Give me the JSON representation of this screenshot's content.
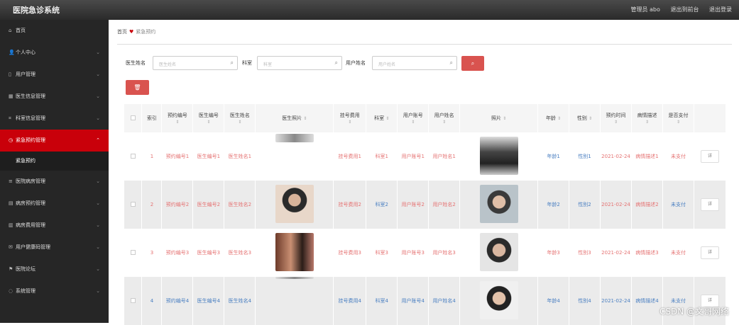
{
  "app": {
    "title": "医院急诊系统"
  },
  "topbar": {
    "user": "管理员 abo",
    "front": "退出到前台",
    "logout": "退出登录"
  },
  "sidebar": {
    "items": [
      {
        "icon": "⌂",
        "label": "首页"
      },
      {
        "icon": "👤",
        "label": "个人中心"
      },
      {
        "icon": "▯",
        "label": "用户管理"
      },
      {
        "icon": "▦",
        "label": "医生信息管理"
      },
      {
        "icon": "⌗",
        "label": "科室信息管理"
      },
      {
        "icon": "◷",
        "label": "紧急预约管理"
      },
      {
        "icon": "≡",
        "label": "医院病房管理"
      },
      {
        "icon": "▤",
        "label": "病房预约管理"
      },
      {
        "icon": "▥",
        "label": "病房费用管理"
      },
      {
        "icon": "✉",
        "label": "用户健康码管理"
      },
      {
        "icon": "⚑",
        "label": "医院论坛"
      },
      {
        "icon": "◌",
        "label": "系统管理"
      }
    ],
    "submenu": "紧急预约"
  },
  "breadcrumb": {
    "home": "首页",
    "current": "紧急预约"
  },
  "filters": {
    "doctor_label": "医生姓名",
    "doctor_placeholder": "医生姓名",
    "dept_label": "科室",
    "dept_placeholder": "科室",
    "user_label": "用户姓名",
    "user_placeholder": "用户姓名"
  },
  "table": {
    "headers": [
      "索引",
      "预约编号",
      "医生编号",
      "医生姓名",
      "医生照片",
      "挂号费用",
      "科室",
      "用户账号",
      "用户姓名",
      "照片",
      "年龄",
      "性别",
      "预约时间",
      "病情描述",
      "是否支付"
    ],
    "rows": [
      {
        "idx": "1",
        "appt": "预约编号1",
        "doc_no": "医生编号1",
        "doc_name": "医生姓名1",
        "fee": "挂号费用1",
        "dept": "科室1",
        "acct": "用户账号1",
        "uname": "用户姓名1",
        "age": "年龄1",
        "sex": "性别1",
        "time": "2021-02-24",
        "desc": "病情描述1",
        "paid": "未支付"
      },
      {
        "idx": "2",
        "appt": "预约编号2",
        "doc_no": "医生编号2",
        "doc_name": "医生姓名2",
        "fee": "挂号费用2",
        "dept": "科室2",
        "acct": "用户账号2",
        "uname": "用户姓名2",
        "age": "年龄2",
        "sex": "性别2",
        "time": "2021-02-24",
        "desc": "病情描述2",
        "paid": "未支付"
      },
      {
        "idx": "3",
        "appt": "预约编号3",
        "doc_no": "医生编号3",
        "doc_name": "医生姓名3",
        "fee": "挂号费用3",
        "dept": "科室3",
        "acct": "用户账号3",
        "uname": "用户姓名3",
        "age": "年龄3",
        "sex": "性别3",
        "time": "2021-02-24",
        "desc": "病情描述3",
        "paid": "未支付"
      },
      {
        "idx": "4",
        "appt": "预约编号4",
        "doc_no": "医生编号4",
        "doc_name": "医生姓名4",
        "fee": "挂号费用4",
        "dept": "科室4",
        "acct": "用户账号4",
        "uname": "用户姓名4",
        "age": "年龄4",
        "sex": "性别4",
        "time": "2021-02-24",
        "desc": "病情描述4",
        "paid": "未支付"
      }
    ],
    "op_label": "详"
  },
  "watermark": "CSDN @文哥网络"
}
